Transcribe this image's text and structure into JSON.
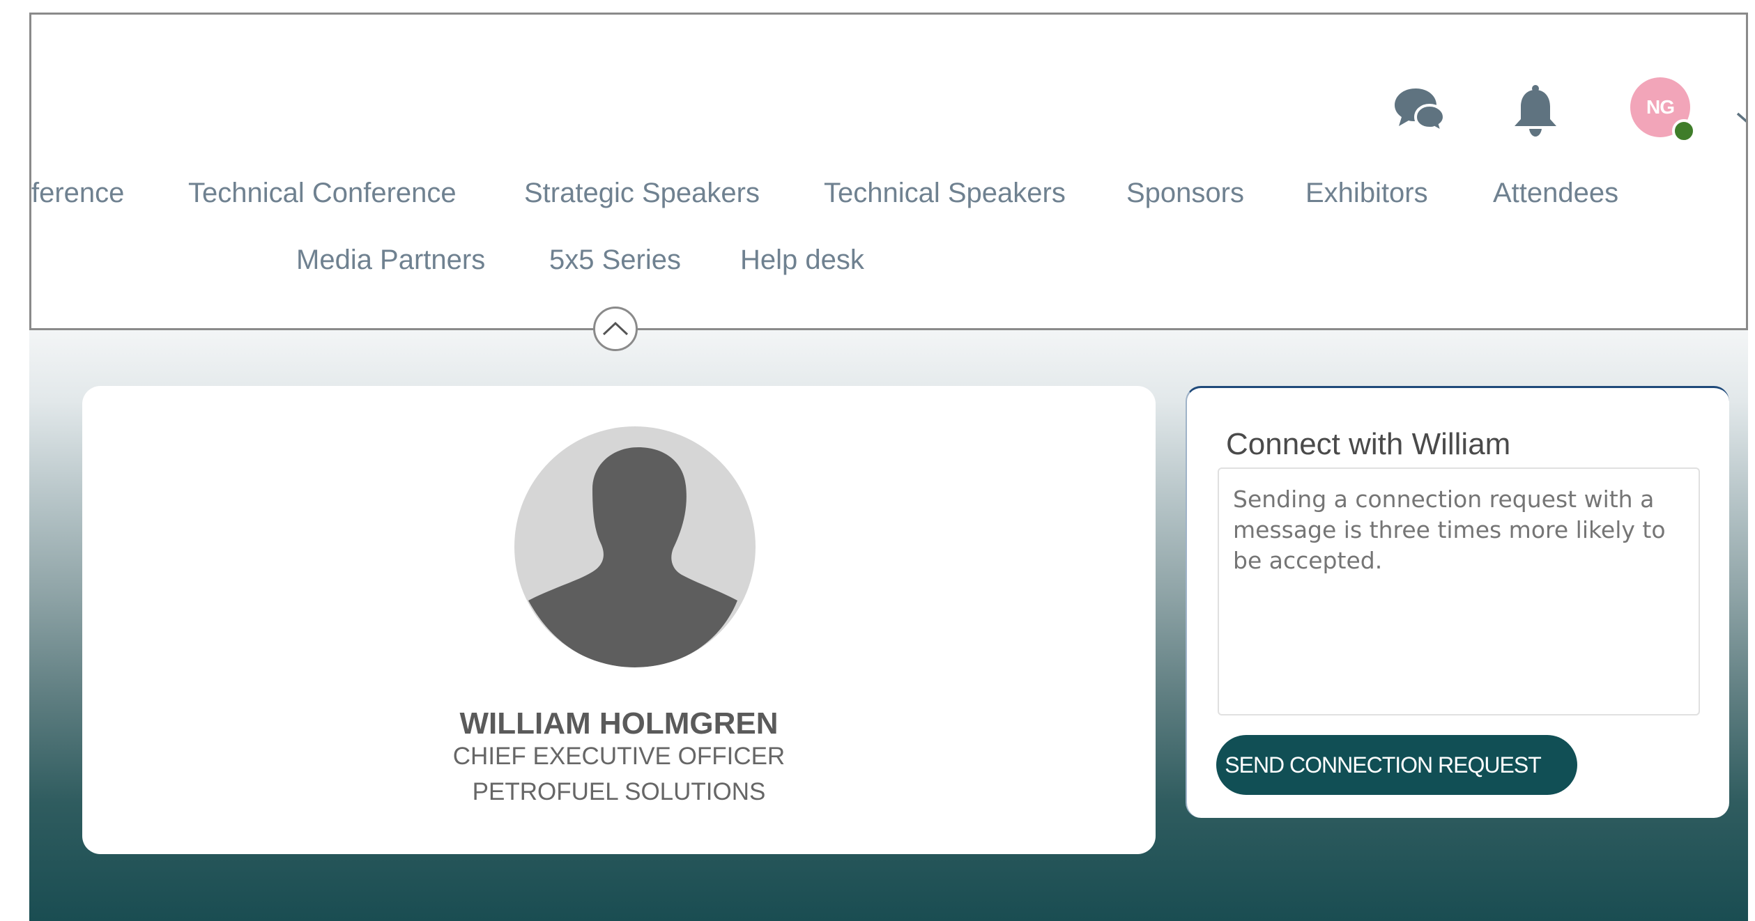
{
  "header": {
    "avatar_initials": "NG",
    "nav_row1": [
      "ference",
      "Technical Conference",
      "Strategic Speakers",
      "Technical Speakers",
      "Sponsors",
      "Exhibitors",
      "Attendees"
    ],
    "nav_row2": [
      "Media Partners",
      "5x5 Series",
      "Help desk"
    ],
    "icons": {
      "messages": "chat-bubbles-icon",
      "notifications": "bell-icon",
      "presence": "online-status-dot",
      "menu": "chevron-down-icon",
      "collapse": "chevron-up-icon"
    }
  },
  "profile": {
    "name": "WILLIAM HOLMGREN",
    "title": "CHIEF EXECUTIVE OFFICER",
    "company": "PETROFUEL SOLUTIONS",
    "avatar_icon": "default-person-silhouette"
  },
  "connect": {
    "title": "Connect with William",
    "message_placeholder": "Sending a connection request with a message is three times more likely to be accepted.",
    "send_button": "SEND CONNECTION REQUEST"
  },
  "colors": {
    "primary_button": "#114f55",
    "nav_text": "#6f8190",
    "avatar_bg": "#f2a5b9",
    "presence_green": "#3f7d2a"
  }
}
